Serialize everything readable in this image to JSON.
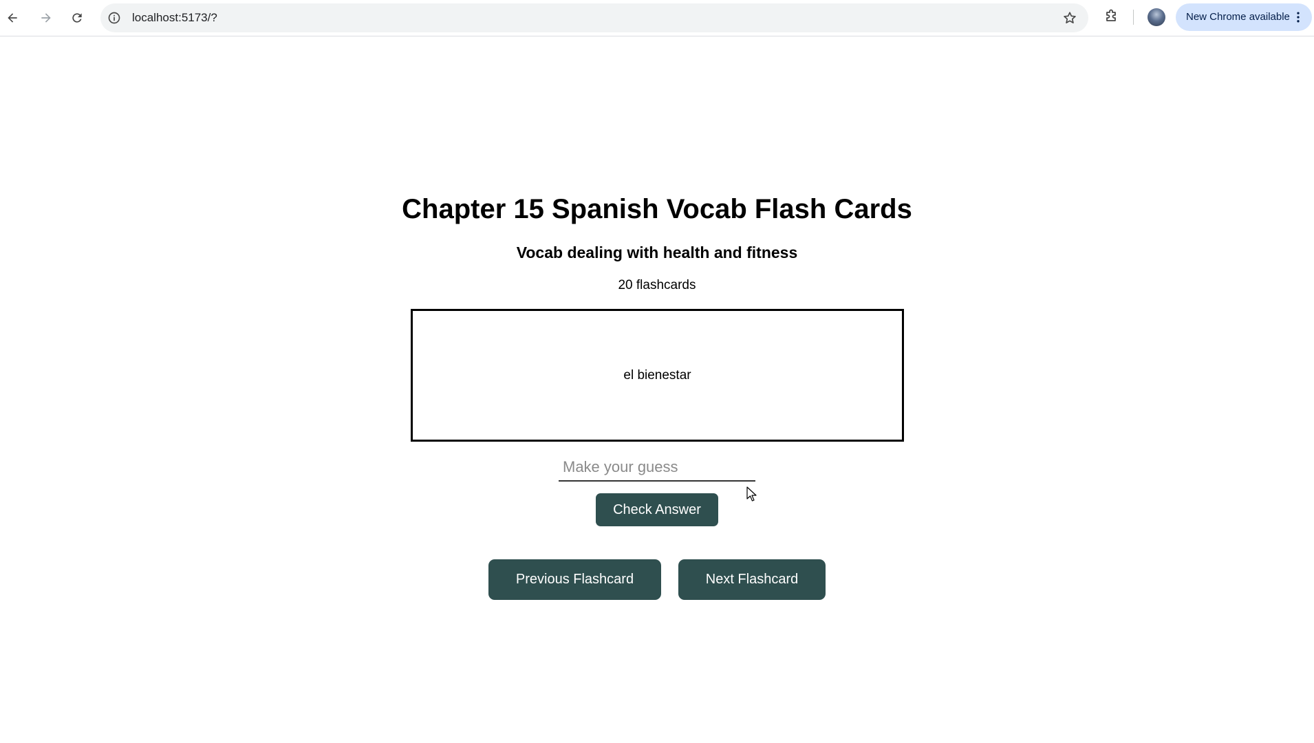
{
  "browser": {
    "url": "localhost:5173/?",
    "update_label": "New Chrome available",
    "icons": {
      "back": "arrow-left-icon",
      "forward": "arrow-right-icon",
      "reload": "reload-icon",
      "site_info": "info-icon",
      "bookmark": "star-icon",
      "extensions": "puzzle-icon",
      "profile": "avatar",
      "menu": "kebab-icon"
    }
  },
  "page": {
    "title": "Chapter 15 Spanish Vocab Flash Cards",
    "subtitle": "Vocab dealing with health and fitness",
    "count_label": "20 flashcards",
    "card_text": "el bienestar",
    "guess": {
      "value": "",
      "placeholder": "Make your guess"
    },
    "check_label": "Check Answer",
    "prev_label": "Previous Flashcard",
    "next_label": "Next Flashcard"
  },
  "colors": {
    "button_bg": "#2f4f4f",
    "button_text": "#ffffff",
    "update_pill_bg": "#d3e3fd"
  }
}
